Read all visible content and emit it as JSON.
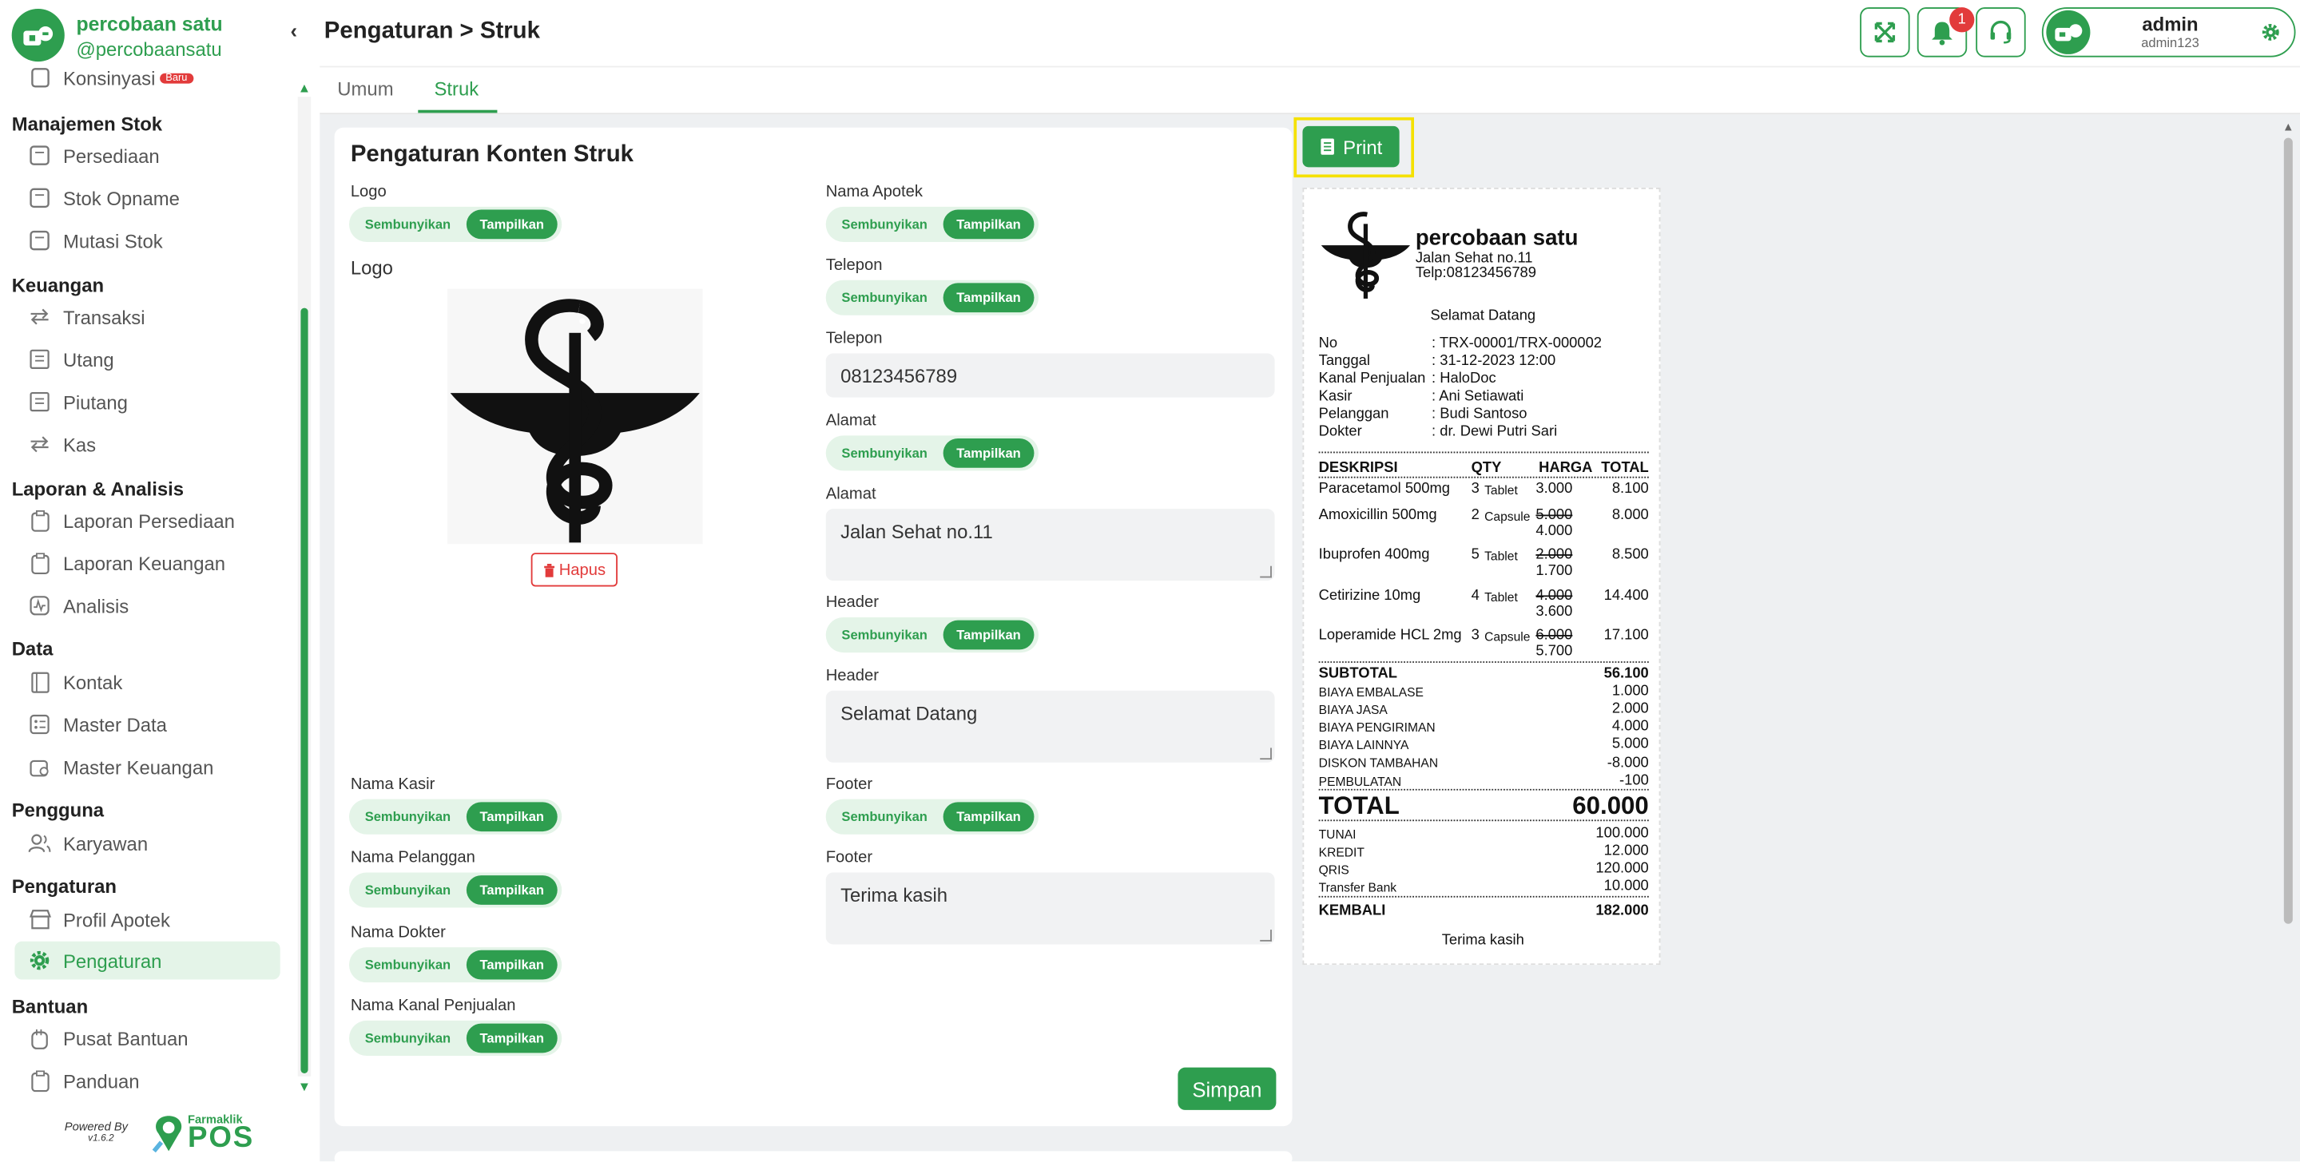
{
  "brand": {
    "name": "percobaan satu",
    "handle": "@percobaansatu"
  },
  "sidebar": {
    "partial_item": {
      "label": "Konsinyasi",
      "badge": "Baru"
    },
    "sections": [
      {
        "title": "Manajemen Stok",
        "items": [
          "Persediaan",
          "Stok Opname",
          "Mutasi Stok"
        ]
      },
      {
        "title": "Keuangan",
        "items": [
          "Transaksi",
          "Utang",
          "Piutang",
          "Kas"
        ]
      },
      {
        "title": "Laporan & Analisis",
        "items": [
          "Laporan Persediaan",
          "Laporan Keuangan",
          "Analisis"
        ]
      },
      {
        "title": "Data",
        "items": [
          "Kontak",
          "Master Data",
          "Master Keuangan"
        ]
      },
      {
        "title": "Pengguna",
        "items": [
          "Karyawan"
        ]
      },
      {
        "title": "Pengaturan",
        "items": [
          "Profil Apotek",
          "Pengaturan"
        ]
      },
      {
        "title": "Bantuan",
        "items": [
          "Pusat Bantuan",
          "Panduan"
        ]
      }
    ],
    "active_item": "Pengaturan",
    "powered_by": "Powered By",
    "version": "v1.6.2",
    "footer_logo_top": "Farmaklik",
    "footer_logo_bottom": "POS"
  },
  "header": {
    "title": "Pengaturan > Struk",
    "notification_count": "1",
    "user_name": "admin",
    "user_handle": "admin123"
  },
  "tabs": [
    "Umum",
    "Struk"
  ],
  "active_tab": "Struk",
  "form": {
    "title": "Pengaturan Konten Struk",
    "toggle_off": "Sembunyikan",
    "toggle_on": "Tampilkan",
    "left": {
      "logo_toggle_label": "Logo",
      "logo_label": "Logo",
      "delete_label": "Hapus",
      "kasir_label": "Nama Kasir",
      "pelanggan_label": "Nama Pelanggan",
      "dokter_label": "Nama Dokter",
      "kanal_label": "Nama Kanal Penjualan"
    },
    "right": {
      "apotek_label": "Nama Apotek",
      "telepon_toggle_label": "Telepon",
      "telepon_label": "Telepon",
      "telepon_value": "08123456789",
      "alamat_toggle_label": "Alamat",
      "alamat_label": "Alamat",
      "alamat_value": "Jalan Sehat no.11",
      "header_toggle_label": "Header",
      "header_label": "Header",
      "header_value": "Selamat Datang",
      "footer_toggle_label": "Footer",
      "footer_label": "Footer",
      "footer_value": "Terima kasih"
    },
    "save_label": "Simpan"
  },
  "print_label": "Print",
  "receipt": {
    "store_name": "percobaan satu",
    "address": "Jalan Sehat no.11",
    "phone": "Telp:08123456789",
    "header": "Selamat Datang",
    "meta": [
      {
        "label": "No",
        "value": ": TRX-00001/TRX-000002"
      },
      {
        "label": "Tanggal",
        "value": ": 31-12-2023 12:00"
      },
      {
        "label": "Kanal Penjualan",
        "value": ": HaloDoc"
      },
      {
        "label": "Kasir",
        "value": ": Ani Setiawati"
      },
      {
        "label": "Pelanggan",
        "value": ": Budi Santoso"
      },
      {
        "label": "Dokter",
        "value": ": dr. Dewi Putri Sari"
      }
    ],
    "columns": [
      "DESKRIPSI",
      "QTY",
      "HARGA",
      "TOTAL"
    ],
    "items": [
      {
        "name": "Paracetamol 500mg",
        "qty": "3",
        "unit": "Tablet",
        "price_old": "",
        "price": "3.000",
        "total": "8.100"
      },
      {
        "name": "Amoxicillin 500mg",
        "qty": "2",
        "unit": "Capsule",
        "price_old": "5.000",
        "price": "4.000",
        "total": "8.000"
      },
      {
        "name": "Ibuprofen 400mg",
        "qty": "5",
        "unit": "Tablet",
        "price_old": "2.000",
        "price": "1.700",
        "total": "8.500"
      },
      {
        "name": "Cetirizine 10mg",
        "qty": "4",
        "unit": "Tablet",
        "price_old": "4.000",
        "price": "3.600",
        "total": "14.400"
      },
      {
        "name": "Loperamide HCL 2mg",
        "qty": "3",
        "unit": "Capsule",
        "price_old": "6.000",
        "price": "5.700",
        "total": "17.100"
      }
    ],
    "subtotal_label": "SUBTOTAL",
    "subtotal": "56.100",
    "charges": [
      {
        "label": "BIAYA EMBALASE",
        "value": "1.000"
      },
      {
        "label": "BIAYA JASA",
        "value": "2.000"
      },
      {
        "label": "BIAYA PENGIRIMAN",
        "value": "4.000"
      },
      {
        "label": "BIAYA LAINNYA",
        "value": "5.000"
      },
      {
        "label": "DISKON TAMBAHAN",
        "value": "-8.000"
      },
      {
        "label": "PEMBULATAN",
        "value": "-100"
      }
    ],
    "total_label": "TOTAL",
    "total": "60.000",
    "payments": [
      {
        "label": "TUNAI",
        "value": "100.000"
      },
      {
        "label": "KREDIT",
        "value": "12.000"
      },
      {
        "label": "QRIS",
        "value": "120.000"
      },
      {
        "label": "Transfer Bank",
        "value": "10.000"
      }
    ],
    "change_label": "KEMBALI",
    "change": "182.000",
    "footer": "Terima kasih"
  },
  "colors": {
    "accent": "#2e9e4f",
    "accent_light": "#e4f4e8",
    "danger": "#e23b3b",
    "highlight": "#f5e100"
  }
}
